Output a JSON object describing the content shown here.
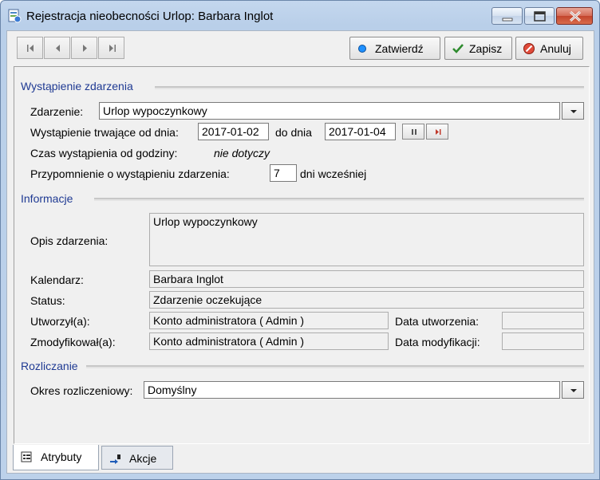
{
  "window": {
    "title": "Rejestracja nieobecności Urlop:  Barbara Inglot"
  },
  "toolbar": {
    "confirm_label": "Zatwierdź",
    "save_label": "Zapisz",
    "cancel_label": "Anuluj"
  },
  "event_section": {
    "title": "Wystąpienie zdarzenia",
    "event_label": "Zdarzenie:",
    "event_value": "Urlop wypoczynkowy",
    "from_label": "Wystąpienie trwające od dnia:",
    "date_from": "2017-01-02",
    "to_label": "do dnia",
    "date_to": "2017-01-04",
    "time_label": "Czas wystąpienia od godziny:",
    "time_value": "nie dotyczy",
    "reminder_label": "Przypomnienie o wystąpieniu zdarzenia:",
    "reminder_value": "7",
    "reminder_suffix": "dni wcześniej"
  },
  "info_section": {
    "title": "Informacje",
    "description_label": "Opis zdarzenia:",
    "description_value": "Urlop wypoczynkowy",
    "calendar_label": "Kalendarz:",
    "calendar_value": "Barbara Inglot",
    "status_label": "Status:",
    "status_value": "Zdarzenie oczekujące",
    "created_by_label": "Utworzył(a):",
    "created_by_value": "Konto administratora ( Admin )",
    "created_date_label": "Data utworzenia:",
    "created_date_value": "",
    "modified_by_label": "Zmodyfikował(a):",
    "modified_by_value": "Konto administratora ( Admin )",
    "modified_date_label": "Data modyfikacji:",
    "modified_date_value": ""
  },
  "settlement_section": {
    "title": "Rozliczanie",
    "period_label": "Okres rozliczeniowy:",
    "period_value": "Domyślny"
  },
  "tabs": [
    {
      "label": "Atrybuty",
      "icon": "attributes-icon",
      "active": true
    },
    {
      "label": "Akcje",
      "icon": "actions-icon",
      "active": false
    }
  ],
  "colors": {
    "section_title": "#1f3a93",
    "confirm_dot": "#1e90ff",
    "save_check": "#2e8b2e",
    "cancel_icon": "#c0392b"
  }
}
